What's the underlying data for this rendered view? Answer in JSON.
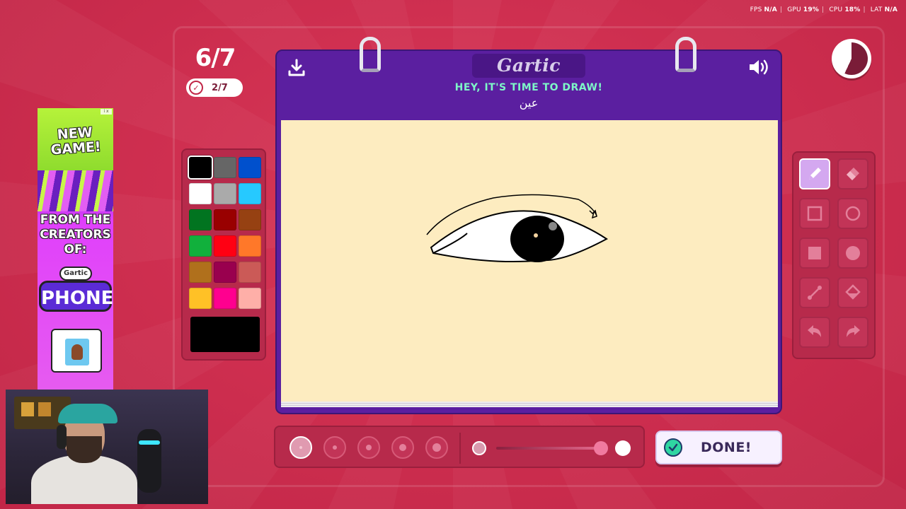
{
  "perf": {
    "fps_label": "FPS",
    "fps_value": "N/A",
    "gpu_label": "GPU",
    "gpu_value": "19%",
    "cpu_label": "CPU",
    "cpu_value": "18%",
    "lat_label": "LAT",
    "lat_value": "N/A"
  },
  "round": {
    "current": "6/7",
    "done_count": "2/7"
  },
  "timer": {
    "remaining_fraction": 0.43
  },
  "ad": {
    "line1": "NEW GAME!",
    "line2": "FROM THE CREATORS OF:",
    "logo_small": "Gartic",
    "logo_big": "PHONE"
  },
  "header": {
    "logo": "Gartic",
    "prompt": "HEY, IT'S TIME TO DRAW!",
    "word": "عين"
  },
  "palette": {
    "selected": "#000000",
    "colors": [
      "#000000",
      "#666666",
      "#0050cd",
      "#ffffff",
      "#aaaaaa",
      "#26c9ff",
      "#017420",
      "#990000",
      "#964112",
      "#11b03c",
      "#ff0013",
      "#ff7829",
      "#b0701c",
      "#99004e",
      "#cb5a57",
      "#ffc126",
      "#ff008f",
      "#feafa8"
    ]
  },
  "tools": {
    "active": "pencil",
    "items": [
      "pencil",
      "eraser",
      "rectangle",
      "ellipse",
      "filled-rectangle",
      "filled-ellipse",
      "line",
      "fill",
      "undo",
      "redo"
    ]
  },
  "brush": {
    "sizes": [
      1,
      2,
      3,
      4,
      5
    ],
    "selected_size": 1
  },
  "done_button": {
    "label": "DONE!"
  }
}
